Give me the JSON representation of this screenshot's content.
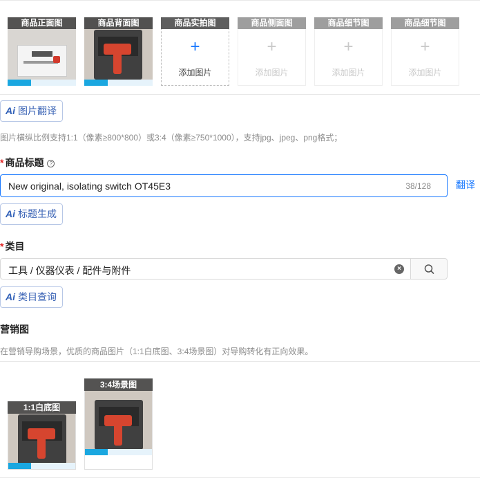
{
  "image_slots": [
    {
      "label": "商品正面图",
      "state": "filled"
    },
    {
      "label": "商品背面图",
      "state": "filled"
    },
    {
      "label": "商品实拍图",
      "state": "add",
      "add_text": "添加图片"
    },
    {
      "label": "商品侧面图",
      "state": "disabled",
      "add_text": "添加图片"
    },
    {
      "label": "商品细节图",
      "state": "disabled",
      "add_text": "添加图片"
    },
    {
      "label": "商品细节图",
      "state": "disabled",
      "add_text": "添加图片"
    }
  ],
  "plus_symbol": "+",
  "image_translate": {
    "ai": "Ai",
    "label": "图片翻译"
  },
  "image_hint": "图片横纵比例支持1:1（像素≥800*800）或3:4（像素≥750*1000），支持jpg、jpeg、png格式；",
  "title_field": {
    "required_mark": "*",
    "label": "商品标题",
    "help_icon": "question-circle",
    "value": "New original, isolating switch OT45E3",
    "counter": "38/128",
    "translate_link": "翻译"
  },
  "title_generate": {
    "ai": "Ai",
    "label": "标题生成"
  },
  "category_field": {
    "required_mark": "*",
    "label": "类目",
    "value": "工具 / 仪器仪表 / 配件与附件",
    "clear_symbol": "×"
  },
  "category_query": {
    "ai": "Ai",
    "label": "类目查询"
  },
  "marketing": {
    "label": "营销图",
    "hint": "在营销导购场景，优质的商品图片（1:1白底图、3:4场景图）对导购转化有正向效果。",
    "slots": [
      {
        "label": "1:1白底图"
      },
      {
        "label": "3:4场景图"
      }
    ]
  },
  "colors": {
    "accent": "#1677ff",
    "required": "#e02424",
    "ai_text": "#3a63b5"
  }
}
